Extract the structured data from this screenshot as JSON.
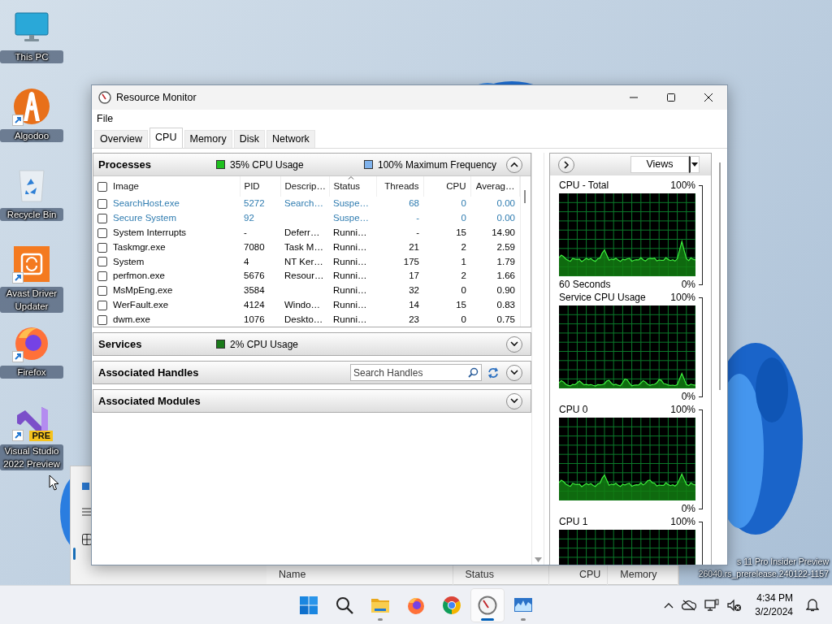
{
  "desktop_icons": [
    {
      "kind": "monitor",
      "label": "This PC",
      "shortcut": false
    },
    {
      "kind": "algodoo",
      "label": "Algodoo",
      "shortcut": true
    },
    {
      "kind": "recycle",
      "label": "Recycle Bin",
      "shortcut": false
    },
    {
      "kind": "avast",
      "label": "Avast Driver Updater",
      "shortcut": true
    },
    {
      "kind": "firefox",
      "label": "Firefox",
      "shortcut": true
    },
    {
      "kind": "vs",
      "label": "Visual Studio 2022 Preview",
      "badge": "PRE",
      "shortcut": true
    }
  ],
  "background_window": {
    "columns": [
      "Name",
      "Status",
      "CPU",
      "Memory"
    ]
  },
  "window": {
    "title": "Resource Monitor",
    "menu": [
      "File"
    ],
    "tabs": [
      {
        "label": "Overview",
        "selected": false
      },
      {
        "label": "CPU",
        "selected": true
      },
      {
        "label": "Memory",
        "selected": false
      },
      {
        "label": "Disk",
        "selected": false
      },
      {
        "label": "Network",
        "selected": false
      }
    ]
  },
  "processes": {
    "title": "Processes",
    "usage": "35% CPU Usage",
    "frequency": "100% Maximum Frequency",
    "expanded": true,
    "all_checked": false,
    "columns": [
      {
        "label": "Image",
        "sorted": false
      },
      {
        "label": "PID",
        "sorted": false
      },
      {
        "label": "Descrip…",
        "sorted": false
      },
      {
        "label": "Status",
        "sorted": true
      },
      {
        "label": "Threads",
        "sorted": false
      },
      {
        "label": "CPU",
        "sorted": false
      },
      {
        "label": "Averag…",
        "sorted": false
      }
    ],
    "rows": [
      {
        "image": "SearchHost.exe",
        "pid": "5272",
        "description": "Search…",
        "status": "Suspe…",
        "threads": "68",
        "cpu": "0",
        "average": "0.00",
        "checked": false,
        "suspended": true
      },
      {
        "image": "Secure System",
        "pid": "92",
        "status": "Suspe…",
        "threads": "-",
        "cpu": "0",
        "average": "0.00",
        "checked": false,
        "suspended": true
      },
      {
        "image": "System Interrupts",
        "pid": "-",
        "description": "Deferr…",
        "status": "Runni…",
        "threads": "-",
        "cpu": "15",
        "average": "14.90",
        "checked": false,
        "suspended": false
      },
      {
        "image": "Taskmgr.exe",
        "pid": "7080",
        "description": "Task M…",
        "status": "Runni…",
        "threads": "21",
        "cpu": "2",
        "average": "2.59",
        "checked": false,
        "suspended": false
      },
      {
        "image": "System",
        "pid": "4",
        "description": "NT Ker…",
        "status": "Runni…",
        "threads": "175",
        "cpu": "1",
        "average": "1.79",
        "checked": false,
        "suspended": false
      },
      {
        "image": "perfmon.exe",
        "pid": "5676",
        "description": "Resour…",
        "status": "Runni…",
        "threads": "17",
        "cpu": "2",
        "average": "1.66",
        "checked": false,
        "suspended": false
      },
      {
        "image": "MsMpEng.exe",
        "pid": "3584",
        "status": "Runni…",
        "threads": "32",
        "cpu": "0",
        "average": "0.90",
        "checked": false,
        "suspended": false
      },
      {
        "image": "WerFault.exe",
        "pid": "4124",
        "description": "Windo…",
        "status": "Runni…",
        "threads": "14",
        "cpu": "15",
        "average": "0.83",
        "checked": false,
        "suspended": false
      },
      {
        "image": "dwm.exe",
        "pid": "1076",
        "description": "Deskto…",
        "status": "Runni…",
        "threads": "23",
        "cpu": "0",
        "average": "0.75",
        "checked": false,
        "suspended": false
      }
    ]
  },
  "services": {
    "title": "Services",
    "usage": "2% CPU Usage",
    "expanded": false
  },
  "handles": {
    "title": "Associated Handles",
    "placeholder": "Search Handles",
    "expanded": false
  },
  "modules": {
    "title": "Associated Modules",
    "expanded": false
  },
  "graphs": {
    "views": "Views",
    "items": [
      {
        "title": "CPU - Total",
        "max": "100%",
        "footer": "60 Seconds",
        "min": "0%"
      },
      {
        "title": "Service CPU Usage",
        "max": "100%",
        "min": "0%"
      },
      {
        "title": "CPU 0",
        "max": "100%",
        "min": "0%"
      },
      {
        "title": "CPU 1",
        "max": "100%"
      }
    ]
  },
  "build_info": [
    "s 11 Pro Insider Preview",
    "26040.rs_prerelease.240122-1157"
  ],
  "taskbar": {
    "apps": [
      {
        "kind": "start",
        "running": false,
        "selected": false
      },
      {
        "kind": "search",
        "running": false,
        "selected": false
      },
      {
        "kind": "explorer",
        "running": true,
        "selected": false
      },
      {
        "kind": "firefox",
        "running": false,
        "selected": false
      },
      {
        "kind": "chrome",
        "running": false,
        "selected": false
      },
      {
        "kind": "resmon",
        "running": true,
        "selected": true
      },
      {
        "kind": "perfmon",
        "running": true,
        "selected": false
      }
    ],
    "time": "4:34 PM",
    "date": "3/2/2024"
  }
}
